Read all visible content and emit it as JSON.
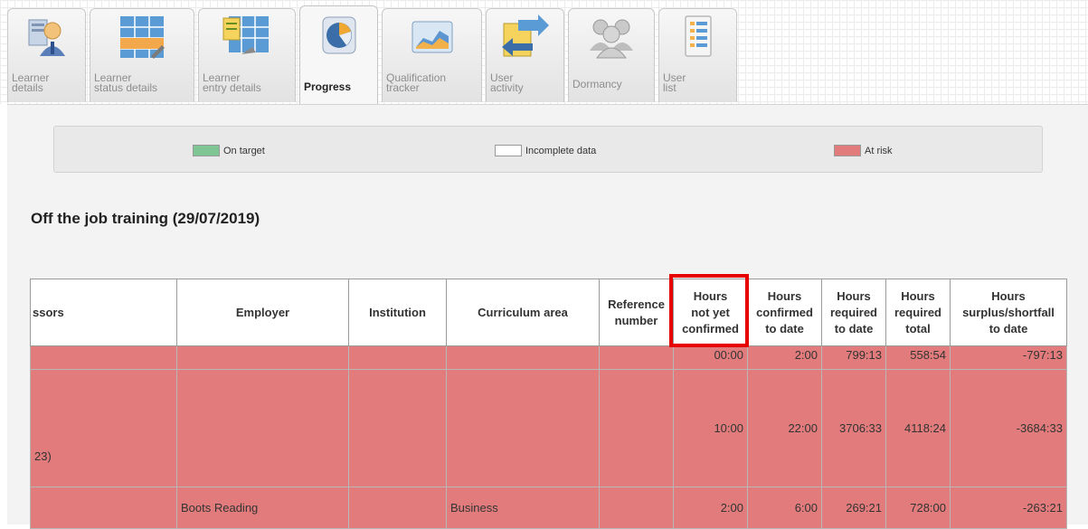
{
  "tabs": [
    {
      "label": "Learner\ndetails",
      "icon": "learner-icon"
    },
    {
      "label": "Learner\nstatus details",
      "icon": "status-table-icon"
    },
    {
      "label": "Learner\nentry details",
      "icon": "entry-table-icon"
    },
    {
      "label": "Progress",
      "icon": "pie-chart-icon",
      "active": true
    },
    {
      "label": "Qualification\ntracker",
      "icon": "area-chart-icon"
    },
    {
      "label": "User\nactivity",
      "icon": "arrows-icon"
    },
    {
      "label": "Dormancy",
      "icon": "users-icon"
    },
    {
      "label": "User\nlist",
      "icon": "list-icon"
    }
  ],
  "legend": {
    "on_target": "On target",
    "incomplete": "Incomplete data",
    "at_risk": "At risk",
    "colors": {
      "on_target": "#7fc694",
      "incomplete": "#ffffff",
      "at_risk": "#e27c7c"
    }
  },
  "section_title": "Off the job training (29/07/2019)",
  "table": {
    "headers": {
      "assessors": "ssors",
      "employer": "Employer",
      "institution": "Institution",
      "curriculum": "Curriculum area",
      "reference": "Reference\nnumber",
      "not_confirmed": "Hours\nnot yet\nconfirmed",
      "confirmed": "Hours\nconfirmed\nto date",
      "required_to_date": "Hours\nrequired\nto date",
      "required_total": "Hours\nrequired\ntotal",
      "surplus": "Hours\nsurplus/shortfall\nto date"
    },
    "rows": [
      {
        "assessors": "",
        "employer": "",
        "institution": "",
        "curriculum": "",
        "reference": "",
        "not_confirmed": "00:00",
        "confirmed": "2:00",
        "required_to_date": "799:13",
        "required_total": "558:54",
        "surplus": "-797:13"
      },
      {
        "assessors": "23)",
        "employer": "",
        "institution": "",
        "curriculum": "",
        "reference": "",
        "not_confirmed": "10:00",
        "confirmed": "22:00",
        "required_to_date": "3706:33",
        "required_total": "4118:24",
        "surplus": "-3684:33"
      },
      {
        "assessors": "",
        "employer": "Boots Reading",
        "institution": "",
        "curriculum": "Business",
        "reference": "",
        "not_confirmed": "2:00",
        "confirmed": "6:00",
        "required_to_date": "269:21",
        "required_total": "728:00",
        "surplus": "-263:21"
      }
    ]
  }
}
